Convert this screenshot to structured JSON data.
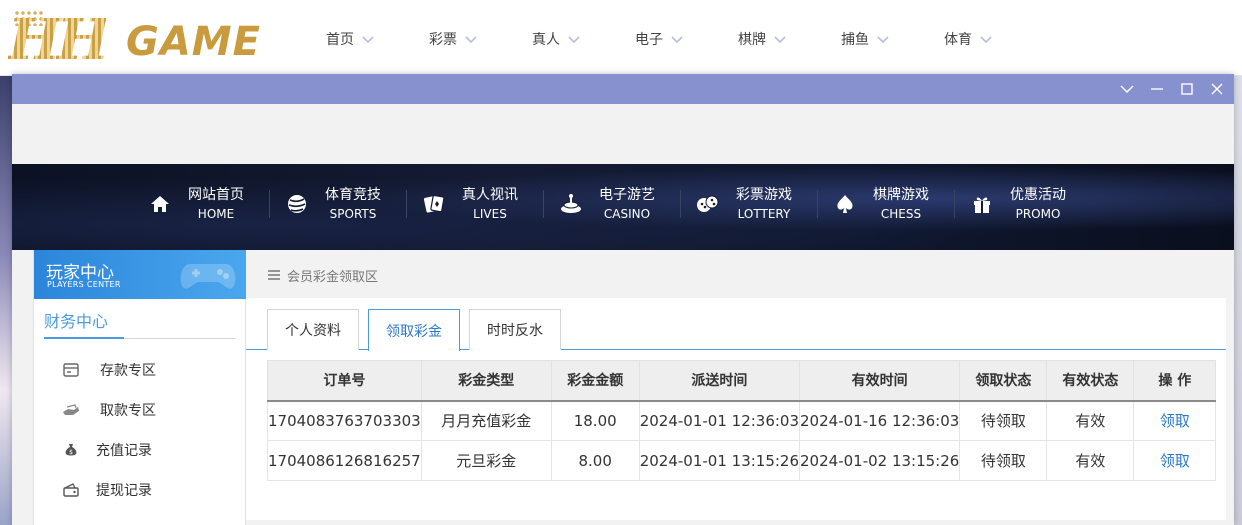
{
  "brand": {
    "logo_hh": "HH",
    "logo_game": "GAME"
  },
  "topnav": {
    "items": [
      {
        "label": "首页"
      },
      {
        "label": "彩票"
      },
      {
        "label": "真人"
      },
      {
        "label": "电子"
      },
      {
        "label": "棋牌"
      },
      {
        "label": "捕鱼"
      },
      {
        "label": "体育"
      }
    ]
  },
  "banner_nav": {
    "items": [
      {
        "cn": "网站首页",
        "en": "HOME",
        "icon": "home-icon"
      },
      {
        "cn": "体育竞技",
        "en": "SPORTS",
        "icon": "ball-icon"
      },
      {
        "cn": "真人视讯",
        "en": "LIVES",
        "icon": "cards-icon"
      },
      {
        "cn": "电子游艺",
        "en": "CASINO",
        "icon": "slot-icon"
      },
      {
        "cn": "彩票游戏",
        "en": "LOTTERY",
        "icon": "dice-icon"
      },
      {
        "cn": "棋牌游戏",
        "en": "CHESS",
        "icon": "spade-icon"
      },
      {
        "cn": "优惠活动",
        "en": "PROMO",
        "icon": "gift-icon"
      }
    ]
  },
  "sidebar": {
    "header_cn": "玩家中心",
    "header_en": "PLAYERS CENTER",
    "section_title": "财务中心",
    "items": [
      {
        "label": "存款专区",
        "icon": "deposit-icon"
      },
      {
        "label": "取款专区",
        "icon": "withdraw-icon"
      },
      {
        "label": "充值记录",
        "icon": "moneybag-icon"
      },
      {
        "label": "提现记录",
        "icon": "wallet-icon"
      }
    ]
  },
  "breadcrumb": "会员彩金领取区",
  "tabs": [
    {
      "label": "个人资料",
      "active": false
    },
    {
      "label": "领取彩金",
      "active": true
    },
    {
      "label": "时时反水",
      "active": false
    }
  ],
  "table": {
    "headers": [
      "订单号",
      "彩金类型",
      "彩金金额",
      "派送时间",
      "有效时间",
      "领取状态",
      "有效状态",
      "操 作"
    ],
    "rows": [
      [
        "1704083763703303",
        "月月充值彩金",
        "18.00",
        "2024-01-01 12:36:03",
        "2024-01-16 12:36:03",
        "待领取",
        "有效",
        "领取"
      ],
      [
        "1704086126816257",
        "元旦彩金",
        "8.00",
        "2024-01-01 13:15:26",
        "2024-01-02 13:15:26",
        "待领取",
        "有效",
        "领取"
      ]
    ]
  },
  "colors": {
    "titlebar": "#8891cf",
    "accent_blue": "#4a9be0",
    "link_blue": "#2a78c8",
    "logo_gold": "#c99a3e"
  }
}
